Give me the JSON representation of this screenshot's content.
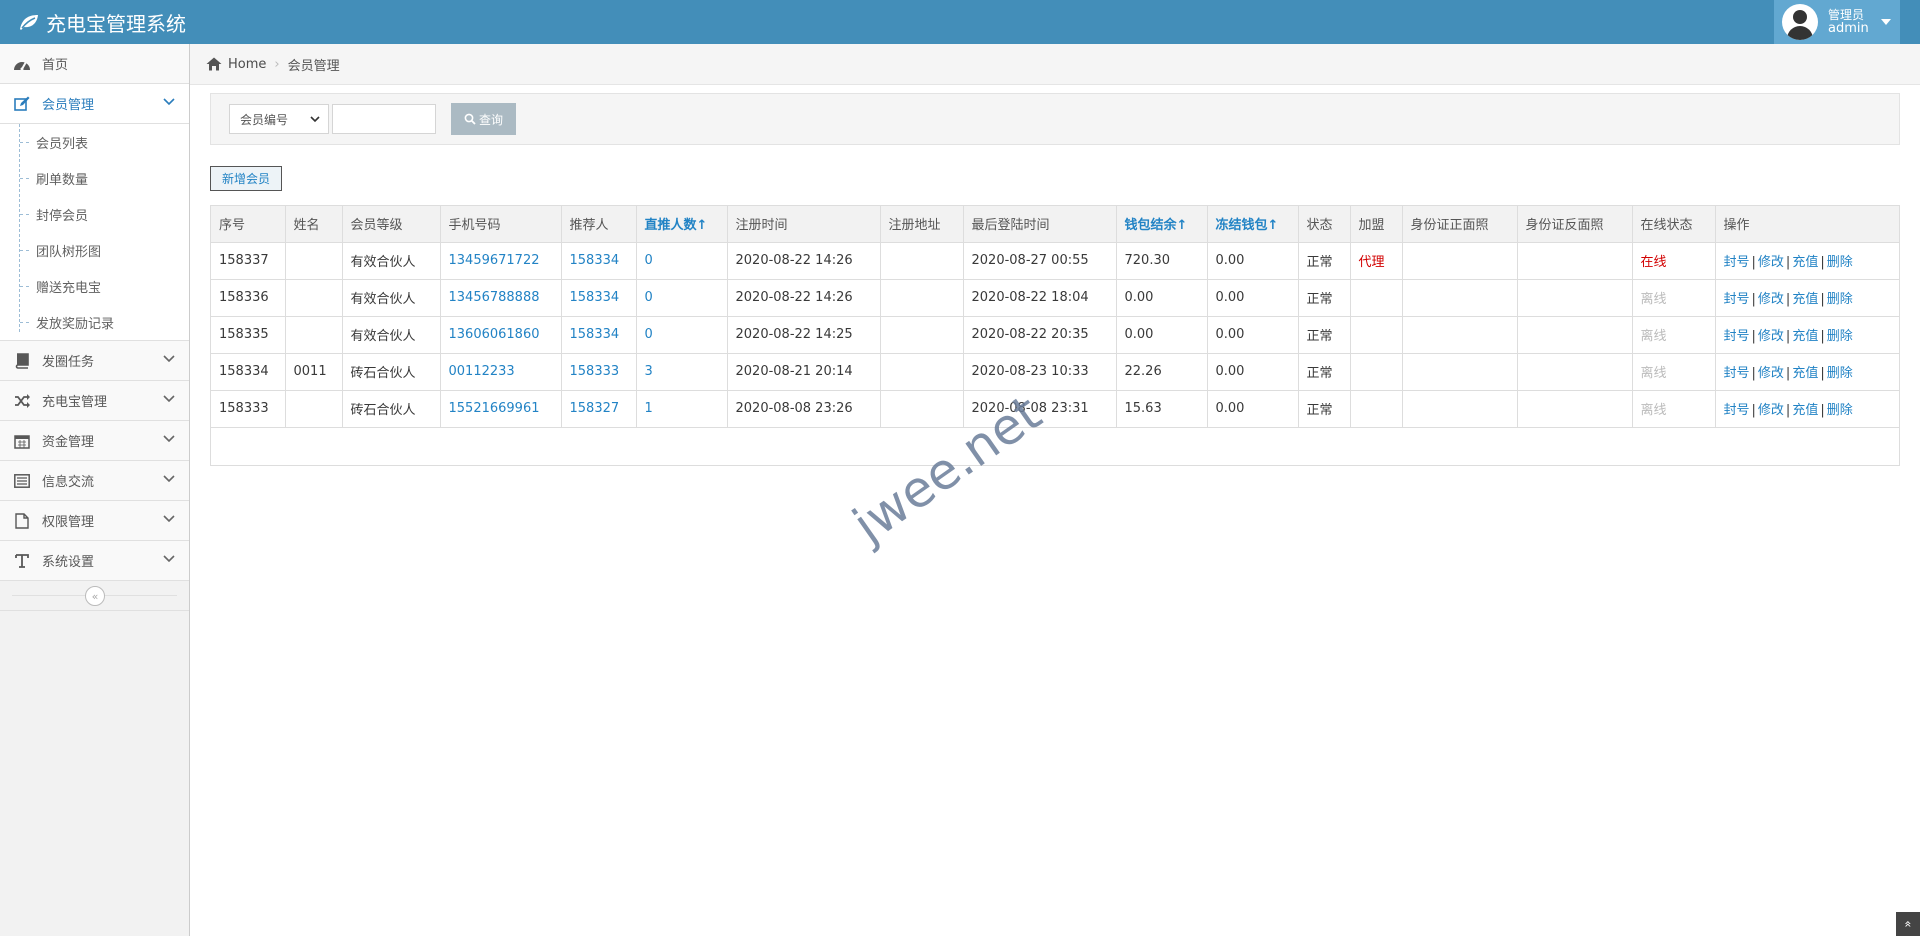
{
  "app": {
    "title": "充电宝管理系统"
  },
  "user": {
    "role": "管理员",
    "name": "admin"
  },
  "sidebar": {
    "items": [
      {
        "label": "首页"
      },
      {
        "label": "会员管理"
      },
      {
        "label": "发圈任务"
      },
      {
        "label": "充电宝管理"
      },
      {
        "label": "资金管理"
      },
      {
        "label": "信息交流"
      },
      {
        "label": "权限管理"
      },
      {
        "label": "系统设置"
      }
    ],
    "submenu": [
      "会员列表",
      "刷单数量",
      "封停会员",
      "团队树形图",
      "赠送充电宝",
      "发放奖励记录"
    ],
    "collapse_icon": "«"
  },
  "breadcrumb": {
    "home": "Home",
    "current": "会员管理"
  },
  "search": {
    "select_value": "会员编号",
    "button": "查询"
  },
  "actions": {
    "add": "新增会员"
  },
  "table": {
    "headers": [
      "序号",
      "姓名",
      "会员等级",
      "手机号码",
      "推荐人",
      "直推人数↑",
      "注册时间",
      "注册地址",
      "最后登陆时间",
      "钱包结余↑",
      "冻结钱包↑",
      "状态",
      "加盟",
      "身份证正面照",
      "身份证反面照",
      "在线状态",
      "操作"
    ],
    "ops": [
      "封号",
      "修改",
      "充值",
      "删除"
    ],
    "rows": [
      {
        "id": "158337",
        "name": "",
        "level": "有效合伙人",
        "phone": "13459671722",
        "referrer": "158334",
        "direct": "0",
        "reg_time": "2020-08-22 14:26",
        "reg_addr": "",
        "last_login": "2020-08-27 00:55",
        "wallet": "720.30",
        "frozen": "0.00",
        "status": "正常",
        "join": "代理",
        "online": "在线"
      },
      {
        "id": "158336",
        "name": "",
        "level": "有效合伙人",
        "phone": "13456788888",
        "referrer": "158334",
        "direct": "0",
        "reg_time": "2020-08-22 14:26",
        "reg_addr": "",
        "last_login": "2020-08-22 18:04",
        "wallet": "0.00",
        "frozen": "0.00",
        "status": "正常",
        "join": "",
        "online": "离线"
      },
      {
        "id": "158335",
        "name": "",
        "level": "有效合伙人",
        "phone": "13606061860",
        "referrer": "158334",
        "direct": "0",
        "reg_time": "2020-08-22 14:25",
        "reg_addr": "",
        "last_login": "2020-08-22 20:35",
        "wallet": "0.00",
        "frozen": "0.00",
        "status": "正常",
        "join": "",
        "online": "离线"
      },
      {
        "id": "158334",
        "name": "0011",
        "level": "砖石合伙人",
        "phone": "00112233",
        "referrer": "158333",
        "direct": "3",
        "reg_time": "2020-08-21 20:14",
        "reg_addr": "",
        "last_login": "2020-08-23 10:33",
        "wallet": "22.26",
        "frozen": "0.00",
        "status": "正常",
        "join": "",
        "online": "离线"
      },
      {
        "id": "158333",
        "name": "",
        "level": "砖石合伙人",
        "phone": "15521669961",
        "referrer": "158327",
        "direct": "1",
        "reg_time": "2020-08-08 23:26",
        "reg_addr": "",
        "last_login": "2020-08-08 23:31",
        "wallet": "15.63",
        "frozen": "0.00",
        "status": "正常",
        "join": "",
        "online": "离线"
      }
    ]
  },
  "watermark": "jwee.net",
  "scroll_top_icon": "»"
}
